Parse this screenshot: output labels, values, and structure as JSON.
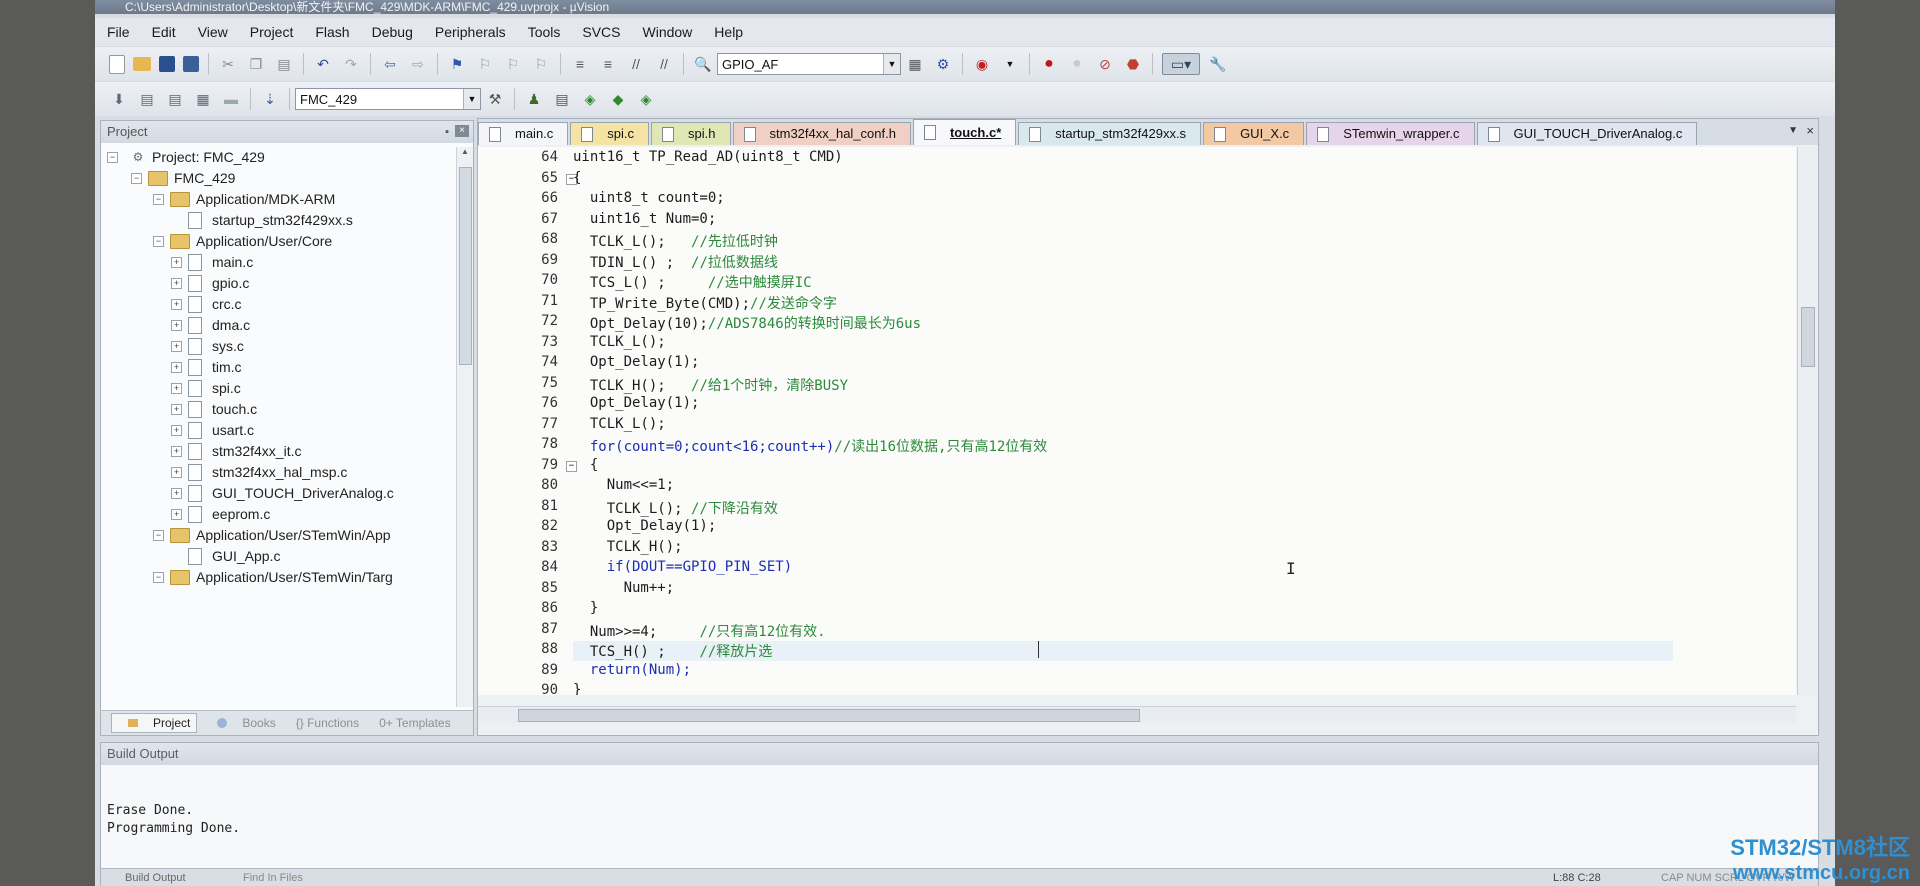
{
  "window": {
    "title": "C:\\Users\\Administrator\\Desktop\\新文件夹\\FMC_429\\MDK-ARM\\FMC_429.uvprojx - µVision"
  },
  "menu": [
    "File",
    "Edit",
    "View",
    "Project",
    "Flash",
    "Debug",
    "Peripherals",
    "Tools",
    "SVCS",
    "Window",
    "Help"
  ],
  "toolbar": {
    "function_combo": "GPIO_AF",
    "target_combo": "FMC_429"
  },
  "project_panel": {
    "title": "Project",
    "tree": [
      {
        "label": "Project: FMC_429",
        "level": 0,
        "type": "root"
      },
      {
        "label": "FMC_429",
        "level": 1,
        "type": "folder"
      },
      {
        "label": "Application/MDK-ARM",
        "level": 2,
        "type": "folder"
      },
      {
        "label": "startup_stm32f429xx.s",
        "level": 3,
        "type": "file"
      },
      {
        "label": "Application/User/Core",
        "level": 2,
        "type": "folder"
      },
      {
        "label": "main.c",
        "level": 3,
        "type": "file"
      },
      {
        "label": "gpio.c",
        "level": 3,
        "type": "file"
      },
      {
        "label": "crc.c",
        "level": 3,
        "type": "file"
      },
      {
        "label": "dma.c",
        "level": 3,
        "type": "file"
      },
      {
        "label": "sys.c",
        "level": 3,
        "type": "file"
      },
      {
        "label": "tim.c",
        "level": 3,
        "type": "file"
      },
      {
        "label": "spi.c",
        "level": 3,
        "type": "file"
      },
      {
        "label": "touch.c",
        "level": 3,
        "type": "file"
      },
      {
        "label": "usart.c",
        "level": 3,
        "type": "file"
      },
      {
        "label": "stm32f4xx_it.c",
        "level": 3,
        "type": "file"
      },
      {
        "label": "stm32f4xx_hal_msp.c",
        "level": 3,
        "type": "file"
      },
      {
        "label": "GUI_TOUCH_DriverAnalog.c",
        "level": 3,
        "type": "file"
      },
      {
        "label": "eeprom.c",
        "level": 3,
        "type": "file"
      },
      {
        "label": "Application/User/STemWin/App",
        "level": 2,
        "type": "folder"
      },
      {
        "label": "GUI_App.c",
        "level": 3,
        "type": "file"
      },
      {
        "label": "Application/User/STemWin/Targ",
        "level": 2,
        "type": "folder"
      }
    ],
    "tabs": [
      "Project",
      "Books",
      "{} Functions",
      "0+ Templates"
    ]
  },
  "editor": {
    "tabs": [
      {
        "label": "main.c",
        "color": "#f3f5f8"
      },
      {
        "label": "spi.c",
        "color": "#f4e3a2"
      },
      {
        "label": "spi.h",
        "color": "#dfe8b5"
      },
      {
        "label": "stm32f4xx_hal_conf.h",
        "color": "#f0cfc4"
      },
      {
        "label": "touch.c*",
        "color": "#f7f8fb"
      },
      {
        "label": "startup_stm32f429xx.s",
        "color": "#d9e8ec"
      },
      {
        "label": "GUI_X.c",
        "color": "#f3c9a4"
      },
      {
        "label": "STemwin_wrapper.c",
        "color": "#e6d4ea"
      },
      {
        "label": "GUI_TOUCH_DriverAnalog.c",
        "color": "#dfe6ef"
      }
    ],
    "lines": [
      {
        "n": "64",
        "code": "uint16_t TP_Read_AD(uint8_t CMD)",
        "comment": ""
      },
      {
        "n": "65",
        "code": "{",
        "comment": ""
      },
      {
        "n": "66",
        "code": "  uint8_t count=0;",
        "comment": ""
      },
      {
        "n": "67",
        "code": "  uint16_t Num=0;",
        "comment": ""
      },
      {
        "n": "68",
        "code": "  TCLK_L();   ",
        "comment": "//先拉低时钟"
      },
      {
        "n": "69",
        "code": "  TDIN_L() ;  ",
        "comment": "//拉低数据线"
      },
      {
        "n": "70",
        "code": "  TCS_L() ;     ",
        "comment": "//选中触摸屏IC"
      },
      {
        "n": "71",
        "code": "  TP_Write_Byte(CMD);",
        "comment": "//发送命令字"
      },
      {
        "n": "72",
        "code": "  Opt_Delay(10);",
        "comment": "//ADS7846的转换时间最长为6us"
      },
      {
        "n": "73",
        "code": "  TCLK_L();",
        "comment": ""
      },
      {
        "n": "74",
        "code": "  Opt_Delay(1);",
        "comment": ""
      },
      {
        "n": "75",
        "code": "  TCLK_H();   ",
        "comment": "//给1个时钟，清除BUSY"
      },
      {
        "n": "76",
        "code": "  Opt_Delay(1);",
        "comment": ""
      },
      {
        "n": "77",
        "code": "  TCLK_L();",
        "comment": ""
      },
      {
        "n": "78",
        "code": "  for(count=0;count<16;count++)",
        "comment": "//读出16位数据,只有高12位有效"
      },
      {
        "n": "79",
        "code": "  {",
        "comment": ""
      },
      {
        "n": "80",
        "code": "    Num<<=1;",
        "comment": ""
      },
      {
        "n": "81",
        "code": "    TCLK_L(); ",
        "comment": "//下降沿有效"
      },
      {
        "n": "82",
        "code": "    Opt_Delay(1);",
        "comment": ""
      },
      {
        "n": "83",
        "code": "    TCLK_H();",
        "comment": ""
      },
      {
        "n": "84",
        "code": "    if(DOUT==GPIO_PIN_SET)",
        "comment": ""
      },
      {
        "n": "85",
        "code": "      Num++;",
        "comment": ""
      },
      {
        "n": "86",
        "code": "  }",
        "comment": ""
      },
      {
        "n": "87",
        "code": "  Num>>=4;     ",
        "comment": "//只有高12位有效."
      },
      {
        "n": "88",
        "code": "  TCS_H() ;    ",
        "comment": "//释放片选"
      },
      {
        "n": "89",
        "code": "  return(Num);",
        "comment": ""
      },
      {
        "n": "90",
        "code": "}",
        "comment": ""
      }
    ]
  },
  "build_output": {
    "title": "Build Output",
    "lines": [
      "Erase Done.",
      "Programming Done."
    ]
  },
  "status_bar": {
    "left": "Build Output",
    "find": "Find In Files",
    "position": "L:88 C:28",
    "caps": "CAP NUM SCRL OVR R/W"
  },
  "watermark": {
    "line1": "STM32/STM8社区",
    "line2": "www.stmcu.org.cn"
  }
}
